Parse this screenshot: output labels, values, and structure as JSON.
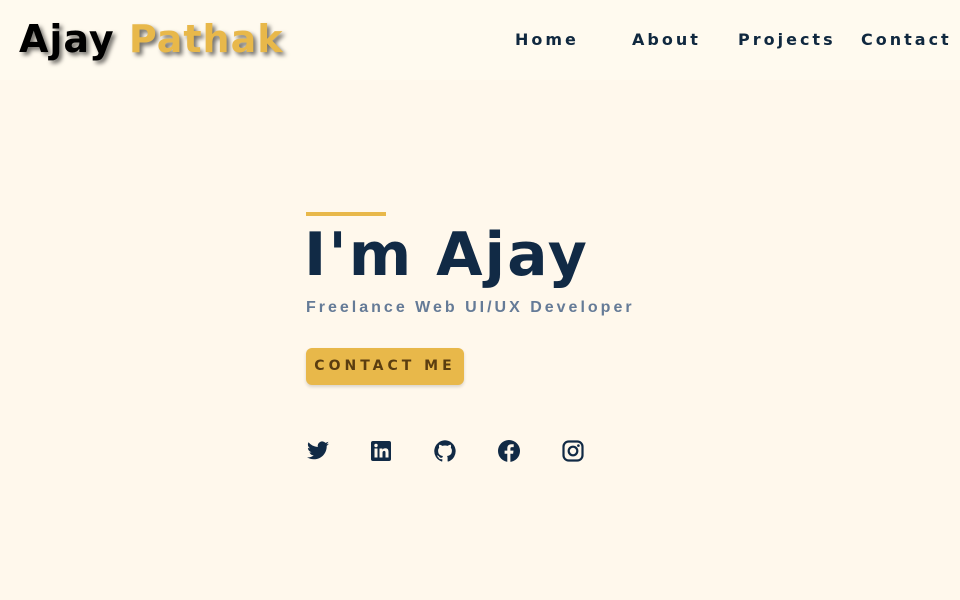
{
  "brand": {
    "first_name": "Ajay",
    "last_name": "Pathak",
    "accent_color": "#e8b84a",
    "text_color": "#000000"
  },
  "nav": {
    "items": [
      {
        "label": "Home"
      },
      {
        "label": "About"
      },
      {
        "label": "Projects"
      },
      {
        "label": "Contact"
      }
    ]
  },
  "hero": {
    "title": "I'm Ajay",
    "subtitle": "Freelance Web UI/UX Developer",
    "cta_label": "CONTACT ME",
    "title_color": "#112a45",
    "subtitle_color": "#657b97"
  },
  "socials": [
    {
      "icon": "twitter-icon"
    },
    {
      "icon": "linkedin-icon"
    },
    {
      "icon": "github-icon"
    },
    {
      "icon": "facebook-icon"
    },
    {
      "icon": "instagram-icon"
    }
  ],
  "colors": {
    "background": "#fff8ec",
    "navbar": "#fffaef",
    "accent": "#e8b84a",
    "icon": "#112a45"
  }
}
